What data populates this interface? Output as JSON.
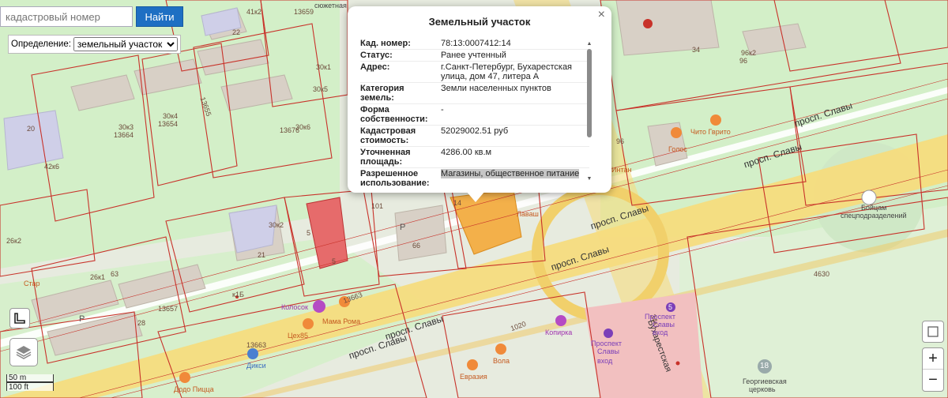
{
  "search": {
    "placeholder": "кадастровый номер",
    "button_label": "Найти"
  },
  "definition": {
    "label": "Определение:",
    "selected": "земельный участок"
  },
  "popup": {
    "title": "Земельный участок",
    "close": "×",
    "rows": [
      {
        "key": "Кад. номер:",
        "value": "78:13:0007412:14"
      },
      {
        "key": "Статус:",
        "value": "Ранее учтенный"
      },
      {
        "key": "Адрес:",
        "value": "г.Санкт-Петербург, Бухарестская улица, дом 47, литера А"
      },
      {
        "key": "Категория земель:",
        "value": "Земли населенных пунктов"
      },
      {
        "key": "Форма собственности:",
        "value": "-"
      },
      {
        "key": "Кадастровая стоимость:",
        "value": "52029002.51 руб"
      },
      {
        "key": "Уточненная площадь:",
        "value": "4286.00 кв.м"
      },
      {
        "key": "Разрешенное использование:",
        "value": "Магазины, общественное питание"
      }
    ]
  },
  "zoom": {
    "in": "+",
    "out": "−"
  },
  "scale": {
    "metric": "50 m",
    "imperial": "100 ft"
  },
  "map": {
    "streets": {
      "slavy_1": "просп. Славы",
      "slavy_2": "просп. Славы",
      "slavy_3": "просп. Славы",
      "slavy_4": "просп. Славы",
      "slavy_5": "просп. Славы",
      "slavy_6": "просп. Славы",
      "bukh": "Бухарестская"
    },
    "parcels": [
      "13659",
      "13664",
      "13654",
      "13655",
      "13676",
      "13657",
      "13663",
      "13663",
      "1020",
      "4630",
      "28",
      "63",
      "21",
      "22",
      "20",
      "34"
    ],
    "houses": [
      "41к2",
      "30к3",
      "30к4",
      "30к6",
      "30к5",
      "42к6",
      "26к1",
      "30к2",
      "26к2",
      "96к2",
      "96",
      "101",
      "66",
      "14",
      "5",
      "5",
      "34к1",
      "30к1"
    ],
    "pois": {
      "chito": "Чито Гврито",
      "golos": "Голос",
      "intan": "Интан",
      "lavash": "Лаваш",
      "bojcy_1": "Бойцам",
      "bojcy_2": "спецподразделений",
      "kolosok": "Колосок",
      "mama": "Мама Рома",
      "cex": "Цех85",
      "diksi": "Дикси",
      "dodo": "Додо Пицца",
      "kopirka": "Копирка",
      "vola": "Вола",
      "evraziya": "Евразия",
      "george_1": "Георгиевская",
      "george_2": "церковь",
      "prospekt_1": "Проспект",
      "prospekt_2": "Славы",
      "prospekt_3": "вход",
      "prospekt_4": "Проспект",
      "prospekt_5": "Славы",
      "prospekt_6": "вход",
      "star": "Стар",
      "syuzhetnaya": "сюжетная",
      "p1": "P",
      "p2": "P",
      "k1": "к1Б",
      "n18": "18",
      "n5": "5",
      "n96": "96"
    }
  },
  "colors": {
    "road_yellow": "#f6dc7e",
    "parcel_line": "#c8322a",
    "green": "#cfeec4",
    "building": "#d6cfc6",
    "highlight": "#f3b04a"
  }
}
